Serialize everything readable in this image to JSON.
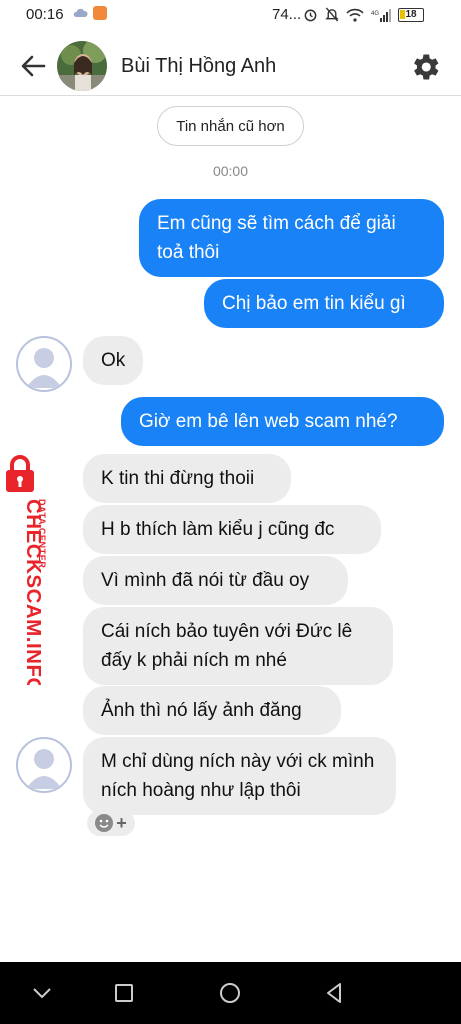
{
  "status_bar": {
    "time": "00:16",
    "carrier_text": "74...",
    "network": "4G",
    "battery": "18"
  },
  "header": {
    "contact_name": "Bùi Thị Hồng Anh"
  },
  "conversation": {
    "older_messages_label": "Tin nhắn cũ hơn",
    "timestamp": "00:00",
    "messages": [
      {
        "from": "me",
        "text": "Em cũng sẽ tìm cách để giải toả thôi"
      },
      {
        "from": "me",
        "text": "Chị bảo em tin kiểu gì"
      },
      {
        "from": "them",
        "text": "Ok"
      },
      {
        "from": "me",
        "text": "Giờ em bê lên web scam nhé?"
      },
      {
        "from": "them",
        "text": "K tin thi đừng thoii"
      },
      {
        "from": "them",
        "text": "H b thích làm kiểu j cũng đc"
      },
      {
        "from": "them",
        "text": "Vì mình đã nói từ đầu oy"
      },
      {
        "from": "them",
        "text": "Cái ních bảo tuyên với Đức lê đấy k phải ních m nhé"
      },
      {
        "from": "them",
        "text": "Ảnh thì nó lấy ảnh đăng"
      },
      {
        "from": "them",
        "text": "M chỉ dùng ních này với ck mình ních hoàng như lập thôi"
      }
    ]
  },
  "watermark": {
    "brand": "CHECKSCAM.INFO",
    "subtitle": "DATA CENTER"
  },
  "colors": {
    "outgoing_bubble": "#1a82f7",
    "incoming_bubble": "#ececec",
    "watermark_red": "#e8232a"
  },
  "icons": {
    "back": "arrow-left-icon",
    "settings": "gear-icon",
    "reaction": "smiley-add-icon",
    "nav": [
      "chevron-down-icon",
      "recents-square-icon",
      "home-circle-icon",
      "back-triangle-icon"
    ]
  }
}
